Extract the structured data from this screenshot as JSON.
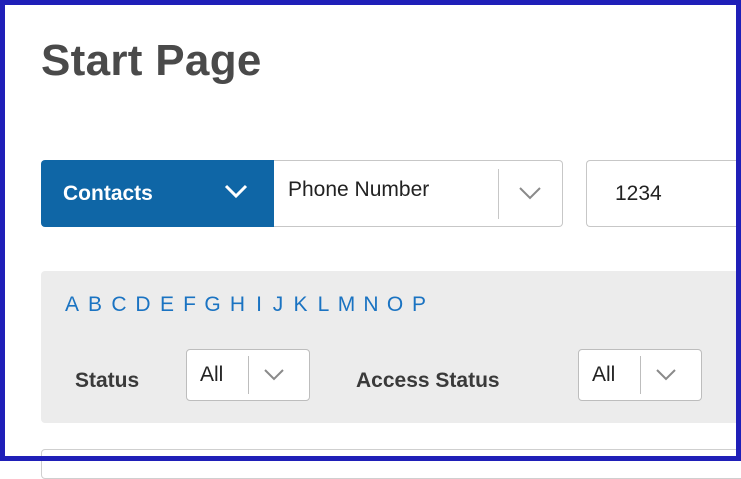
{
  "page": {
    "title": "Start Page"
  },
  "search": {
    "entity_label": "Contacts",
    "field_label": "Phone Number",
    "query_value": "1234"
  },
  "filters": {
    "letters": [
      "A",
      "B",
      "C",
      "D",
      "E",
      "F",
      "G",
      "H",
      "I",
      "J",
      "K",
      "L",
      "M",
      "N",
      "O",
      "P"
    ],
    "status_label": "Status",
    "status_value": "All",
    "access_status_label": "Access Status",
    "access_status_value": "All"
  },
  "colors": {
    "primary": "#0f66a6",
    "link": "#1a73c2",
    "panel": "#ececec",
    "frame": "#1f1fb8"
  },
  "icons": {
    "dropdown": "chevron-down-icon"
  }
}
